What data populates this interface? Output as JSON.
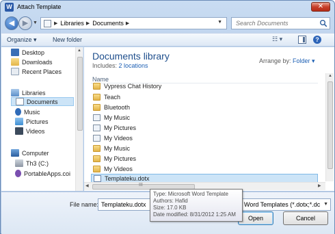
{
  "window": {
    "title": "Attach Template",
    "app_icon_letter": "W",
    "close_glyph": "✕"
  },
  "address": {
    "crumbs": [
      "Libraries",
      "Documents"
    ],
    "search_placeholder": "Search Documents",
    "back_glyph": "◀",
    "forward_glyph": "▶"
  },
  "toolbar": {
    "organize": "Organize ▾",
    "new_folder": "New folder",
    "view": "☷ ▾",
    "help": "?"
  },
  "nav": {
    "items": [
      {
        "label": "Desktop",
        "icon": "desktop-icon"
      },
      {
        "label": "Downloads",
        "icon": "downloads-icon"
      },
      {
        "label": "Recent Places",
        "icon": "recent-places-icon"
      },
      {
        "label": "Libraries",
        "icon": "libraries-icon"
      },
      {
        "label": "Documents",
        "icon": "documents-icon"
      },
      {
        "label": "Music",
        "icon": "music-icon"
      },
      {
        "label": "Pictures",
        "icon": "pictures-icon"
      },
      {
        "label": "Videos",
        "icon": "videos-icon"
      },
      {
        "label": "Computer",
        "icon": "computer-icon"
      },
      {
        "label": "Th3 (C:)",
        "icon": "drive-icon"
      },
      {
        "label": "PortableApps.coi",
        "icon": "portableapps-icon"
      }
    ]
  },
  "main": {
    "library_title": "Documents library",
    "includes_prefix": "Includes: ",
    "includes_link": "2 locations",
    "arrange_label": "Arrange by: ",
    "arrange_value": "Folder ▾",
    "column_name": "Name",
    "files": [
      {
        "name": "Vypress Chat History",
        "type": "folder"
      },
      {
        "name": "Teach",
        "type": "folder"
      },
      {
        "name": "Bluetooth",
        "type": "folder"
      },
      {
        "name": "My Music",
        "type": "special"
      },
      {
        "name": "My Pictures",
        "type": "special"
      },
      {
        "name": "My Videos",
        "type": "special"
      },
      {
        "name": "My Music",
        "type": "folder"
      },
      {
        "name": "My Pictures",
        "type": "folder"
      },
      {
        "name": "My Videos",
        "type": "folder"
      },
      {
        "name": "Templateku.dotx",
        "type": "doc"
      }
    ],
    "hscroll_grip": "III"
  },
  "bottom": {
    "file_name_label": "File name:",
    "file_name_value": "Templateku.dotx",
    "filter_value": "Word Templates (*.dotx;*.dc",
    "open_label": "Open",
    "cancel_label": "Cancel"
  },
  "tooltip": {
    "type": "Type: Microsoft Word Template",
    "authors": "Authors: Hafid",
    "size": "Size: 17.0 KB",
    "modified": "Date modified: 8/31/2012 1:25 AM"
  },
  "colors": {
    "accent": "#1e4e8c",
    "link": "#1c5fb4",
    "selection": "#cce4f7"
  }
}
